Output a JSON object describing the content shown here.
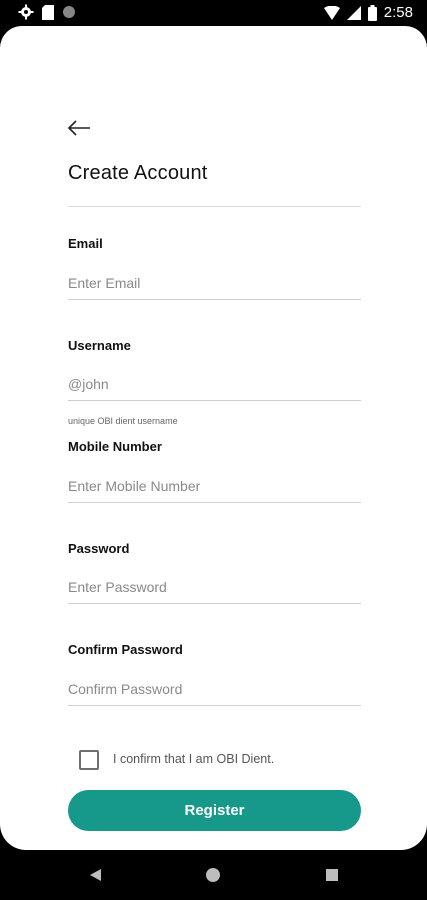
{
  "status_bar": {
    "time": "2:58",
    "icons": [
      "gear-icon",
      "sim-card-icon",
      "circle-icon",
      "wifi-icon",
      "signal-icon",
      "battery-icon"
    ]
  },
  "page": {
    "title": "Create Account"
  },
  "form": {
    "email": {
      "label": "Email",
      "placeholder": "Enter Email"
    },
    "username": {
      "label": "Username",
      "placeholder": "@john",
      "helper": "unique OBI dient username"
    },
    "mobile": {
      "label": "Mobile Number",
      "placeholder": "Enter Mobile Number"
    },
    "password": {
      "label": "Password",
      "placeholder": "Enter Password"
    },
    "confirm_password": {
      "label": "Confirm Password",
      "placeholder": "Confirm Password"
    },
    "confirm_checkbox": {
      "label": "I confirm that I am OBI Dient.",
      "checked": false
    }
  },
  "actions": {
    "register_label": "Register"
  },
  "colors": {
    "accent": "#16988a",
    "text": "#111111",
    "placeholder": "#8a8a8a"
  },
  "nav_bar": {
    "icons": [
      "back-triangle-icon",
      "home-circle-icon",
      "recents-square-icon"
    ]
  }
}
